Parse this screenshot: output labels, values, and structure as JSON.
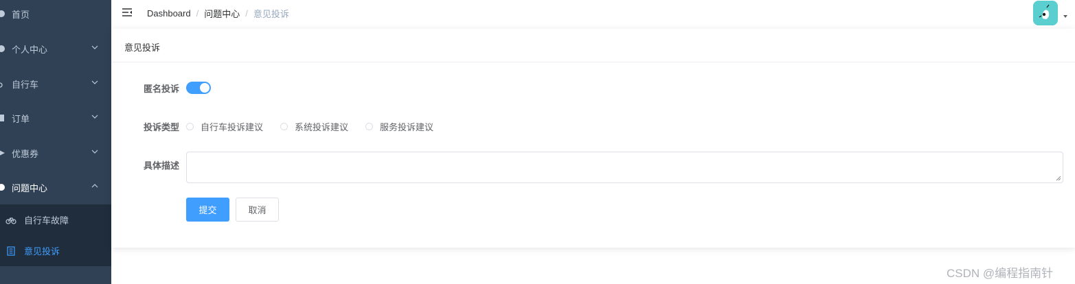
{
  "sidebar": {
    "items": [
      {
        "label": "首页",
        "icon": "home-icon"
      },
      {
        "label": "个人中心",
        "icon": "user-icon"
      },
      {
        "label": "自行车",
        "icon": "bicycle-icon"
      },
      {
        "label": "订单",
        "icon": "order-icon"
      },
      {
        "label": "优惠券",
        "icon": "coupon-icon"
      },
      {
        "label": "问题中心",
        "icon": "question-icon"
      }
    ],
    "subitems": [
      {
        "label": "自行车故障",
        "icon": "bicycle-icon"
      },
      {
        "label": "意见投诉",
        "icon": "document-icon"
      }
    ],
    "active_color": "#409eff",
    "background": "#304156"
  },
  "navbar": {
    "breadcrumb": [
      "Dashboard",
      "问题中心",
      "意见投诉"
    ]
  },
  "card": {
    "title": "意见投诉"
  },
  "form": {
    "anonymous_label": "匿名投诉",
    "anonymous_on": true,
    "type_label": "投诉类型",
    "type_options": [
      "自行车投诉建议",
      "系统投诉建议",
      "服务投诉建议"
    ],
    "description_label": "具体描述",
    "description_value": "",
    "submit_label": "提交",
    "cancel_label": "取消"
  },
  "watermark": "CSDN @编程指南针"
}
